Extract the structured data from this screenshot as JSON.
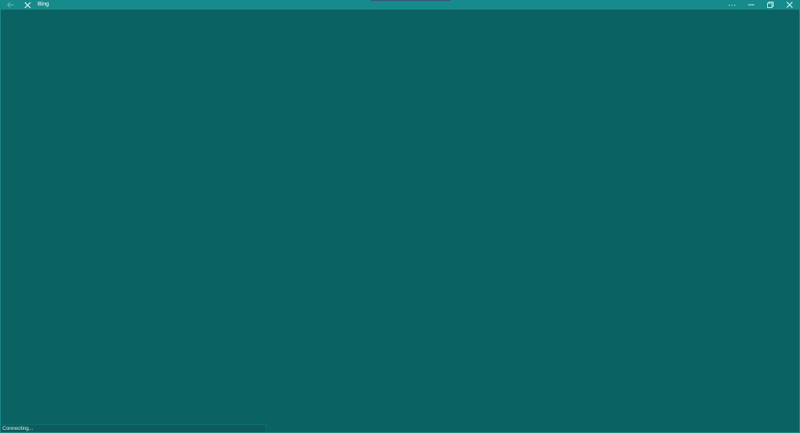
{
  "window": {
    "title": "Bing"
  },
  "titlebar": {
    "back_icon": "arrow-left-icon",
    "stop_icon": "close-x-icon",
    "more_icon": "ellipsis-icon",
    "minimize_icon": "minimize-icon",
    "restore_icon": "restore-icon",
    "close_icon": "close-icon"
  },
  "status": {
    "text": "Connecting..."
  },
  "colors": {
    "titlebar_bg": "#178b8b",
    "content_bg": "#0b6263",
    "text": "#ffffff"
  }
}
